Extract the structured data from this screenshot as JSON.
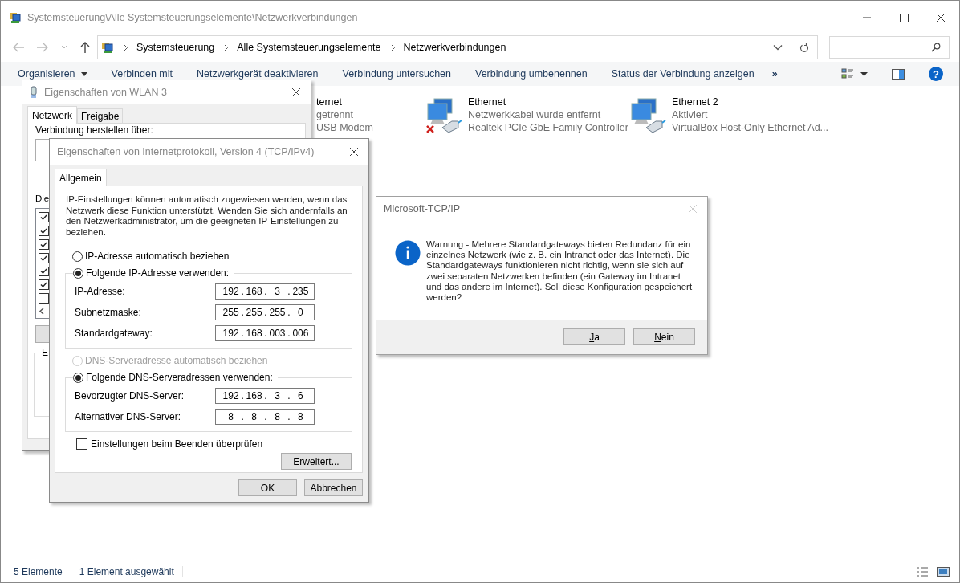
{
  "explorer": {
    "title": "Systemsteuerung\\Alle Systemsteuerungselemente\\Netzwerkverbindungen",
    "breadcrumb": [
      "Systemsteuerung",
      "Alle Systemsteuerungselemente",
      "Netzwerkverbindungen"
    ],
    "toolbar": [
      {
        "label": "Organisieren",
        "dropdown": true
      },
      {
        "label": "Verbinden mit",
        "dropdown": false
      },
      {
        "label": "Netzwerkgerät deaktivieren",
        "dropdown": false
      },
      {
        "label": "Verbindung untersuchen",
        "dropdown": false
      },
      {
        "label": "Verbindung umbenennen",
        "dropdown": false
      },
      {
        "label": "Status der Verbindung anzeigen",
        "dropdown": false
      }
    ],
    "more": "»",
    "help": "?",
    "items": [
      {
        "name": "ternet",
        "status": "getrennt",
        "device": "USB Modem"
      },
      {
        "name": "Ethernet",
        "status": "Netzwerkkabel wurde entfernt",
        "device": "Realtek PCIe GbE Family Controller",
        "disconnected": true
      },
      {
        "name": "Ethernet 2",
        "status": "Aktiviert",
        "device": "VirtualBox Host-Only Ethernet Ad...",
        "disconnected": false
      }
    ],
    "status_bar": [
      "5 Elemente",
      "1 Element ausgewählt"
    ]
  },
  "wlan_dialog": {
    "title": "Eigenschaften von WLAN 3",
    "tabs": [
      {
        "label": "Netzwerk",
        "selected": true
      },
      {
        "label": "Freigabe",
        "selected": false
      }
    ],
    "connect_label": "Verbindung herstellen über:",
    "list_label": "Die",
    "group_label": "E",
    "components": [
      {
        "checked": true
      },
      {
        "checked": true
      },
      {
        "checked": true
      },
      {
        "checked": true
      },
      {
        "checked": true
      },
      {
        "checked": true
      },
      {
        "checked": false
      }
    ]
  },
  "ipv4_dialog": {
    "title": "Eigenschaften von Internetprotokoll, Version 4 (TCP/IPv4)",
    "tabs": [
      {
        "label": "Allgemein",
        "selected": true
      }
    ],
    "description": "IP-Einstellungen können automatisch zugewiesen werden, wenn das Netzwerk diese Funktion unterstützt. Wenden Sie sich andernfalls an den Netzwerkadministrator, um die geeigneten IP-Einstellungen zu beziehen.",
    "separator": ".",
    "sections": [
      {
        "options": [
          {
            "label": "IP-Adresse automatisch beziehen",
            "selected": false,
            "disabled": false
          },
          {
            "label": "Folgende IP-Adresse verwenden:",
            "selected": true,
            "disabled": false
          }
        ],
        "fields": [
          {
            "label": "IP-Adresse:",
            "octets": [
              "192",
              "168",
              "3",
              "235"
            ]
          },
          {
            "label": "Subnetzmaske:",
            "octets": [
              "255",
              "255",
              "255",
              "0"
            ]
          },
          {
            "label": "Standardgateway:",
            "octets": [
              "192",
              "168",
              "003",
              "006"
            ]
          }
        ]
      },
      {
        "options": [
          {
            "label": "DNS-Serveradresse automatisch beziehen",
            "selected": false,
            "disabled": true
          },
          {
            "label": "Folgende DNS-Serveradressen verwenden:",
            "selected": true,
            "disabled": false
          }
        ],
        "fields": [
          {
            "label": "Bevorzugter DNS-Server:",
            "octets": [
              "192",
              "168",
              "3",
              "6"
            ]
          },
          {
            "label": "Alternativer DNS-Server:",
            "octets": [
              "8",
              "8",
              "8",
              "8"
            ]
          }
        ]
      }
    ],
    "validate": {
      "label": "Einstellungen beim Beenden überprüfen",
      "checked": false
    },
    "advanced_button": "Erweitert...",
    "buttons": [
      "OK",
      "Abbrechen"
    ]
  },
  "message_box": {
    "title": "Microsoft-TCP/IP",
    "message": "Warnung - Mehrere Standardgateways bieten Redundanz für ein einzelnes Netzwerk (wie z. B. ein Intranet oder das Internet). Die Standardgateways funktionieren nicht richtig, wenn sie sich auf zwei separaten Netzwerken befinden (ein Gateway im Intranet und das andere im Internet). Soll diese Konfiguration gespeichert werden?",
    "buttons": [
      "Ja",
      "Nein"
    ]
  }
}
